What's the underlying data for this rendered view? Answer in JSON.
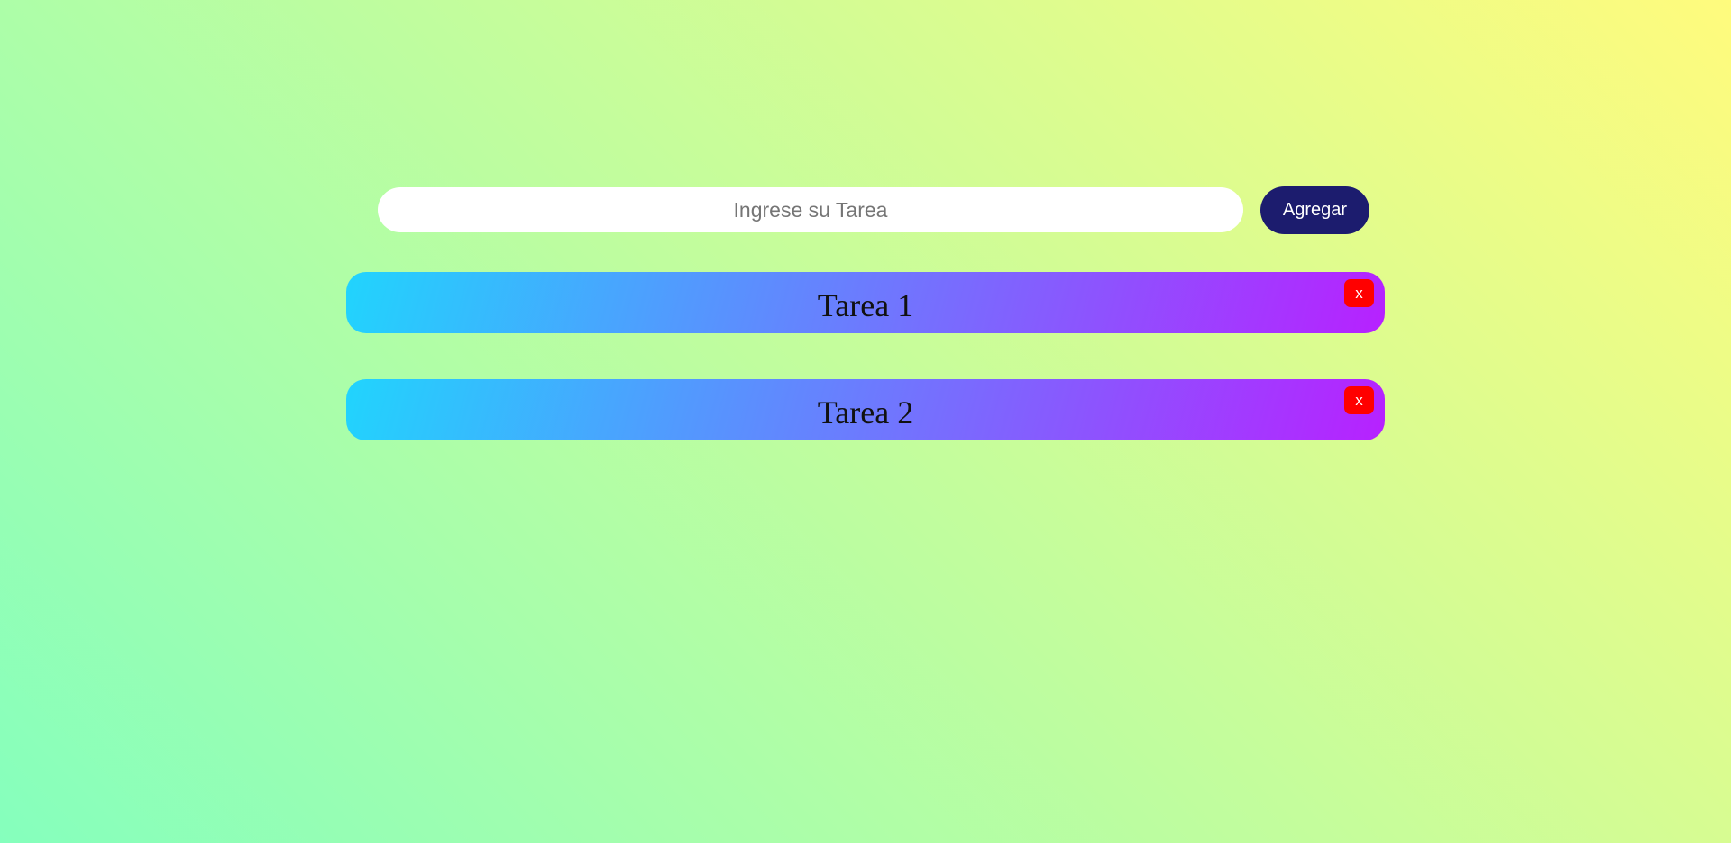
{
  "form": {
    "input_placeholder": "Ingrese su Tarea",
    "input_value": "",
    "add_button_label": "Agregar"
  },
  "tasks": [
    {
      "text": "Tarea 1",
      "delete_label": "x"
    },
    {
      "text": "Tarea 2",
      "delete_label": "x"
    }
  ],
  "colors": {
    "background_gradient_start": "#85FFBD",
    "background_gradient_end": "#FFFB7D",
    "task_gradient_start": "#21D4FD",
    "task_gradient_end": "#B721FF",
    "add_button": "#1c1c6e",
    "delete_button": "#ff0000"
  }
}
